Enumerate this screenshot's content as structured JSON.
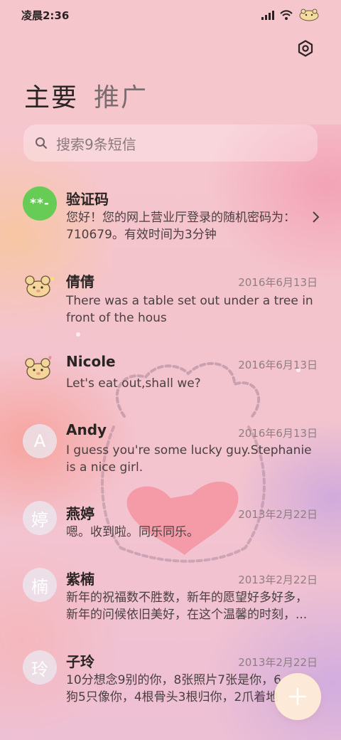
{
  "status_bar": {
    "time": "凌晨2:36",
    "icons": [
      "signal-icon",
      "wifi-icon",
      "battery-icon"
    ]
  },
  "header": {
    "settings_icon": "settings-icon",
    "tabs": [
      {
        "label": "主要",
        "active": true
      },
      {
        "label": "推广",
        "active": false
      }
    ]
  },
  "search": {
    "placeholder": "搜索9条短信",
    "icon": "search-icon"
  },
  "conversations": [
    {
      "avatar": "**-",
      "avatar_type": "green",
      "name": "验证码",
      "date": "",
      "preview_lines": [
        "您好！您的网上营业厅登录的随机密码为：",
        "710679。有效时间为3分钟"
      ],
      "has_chevron": true
    },
    {
      "avatar": "bear",
      "avatar_type": "bear",
      "name": "倩倩",
      "date": "2016年6月13日",
      "preview_lines": [
        "There was a table set out under a tree in",
        "front of the hous"
      ]
    },
    {
      "avatar": "bear",
      "avatar_type": "bear",
      "name": "Nicole",
      "date": "2016年6月13日",
      "preview_lines": [
        "Let's eat out,shall we?"
      ]
    },
    {
      "avatar": "A",
      "avatar_type": "letter",
      "name": "Andy",
      "date": "2016年6月13日",
      "preview_lines": [
        "I guess you're some lucky guy.Stephanie",
        "is a nice girl."
      ]
    },
    {
      "avatar": "婷",
      "avatar_type": "letter",
      "name": "燕婷",
      "date": "2013年2月22日",
      "preview_lines": [
        "嗯。收到啦。同乐同乐。"
      ]
    },
    {
      "avatar": "楠",
      "avatar_type": "letter",
      "name": "紫楠",
      "date": "2013年2月22日",
      "preview_lines": [
        "新年的祝福数不胜数，新年的愿望好多好多，",
        "新年的问候依旧美好，在这个温馨的时刻，..."
      ]
    },
    {
      "avatar": "玲",
      "avatar_type": "letter",
      "name": "子玲",
      "date": "2013年2月22日",
      "preview_lines": [
        "10分想念9别的你，8张照片7张是你，6",
        "狗5只像你，4根骨头3根归你，2爪着地"
      ]
    }
  ],
  "fab": {
    "icon": "plus-icon"
  },
  "colors": {
    "header_bg": "#f6c6cd",
    "green_avatar": "#66cc55",
    "fab_bg": "#ffeed7"
  }
}
